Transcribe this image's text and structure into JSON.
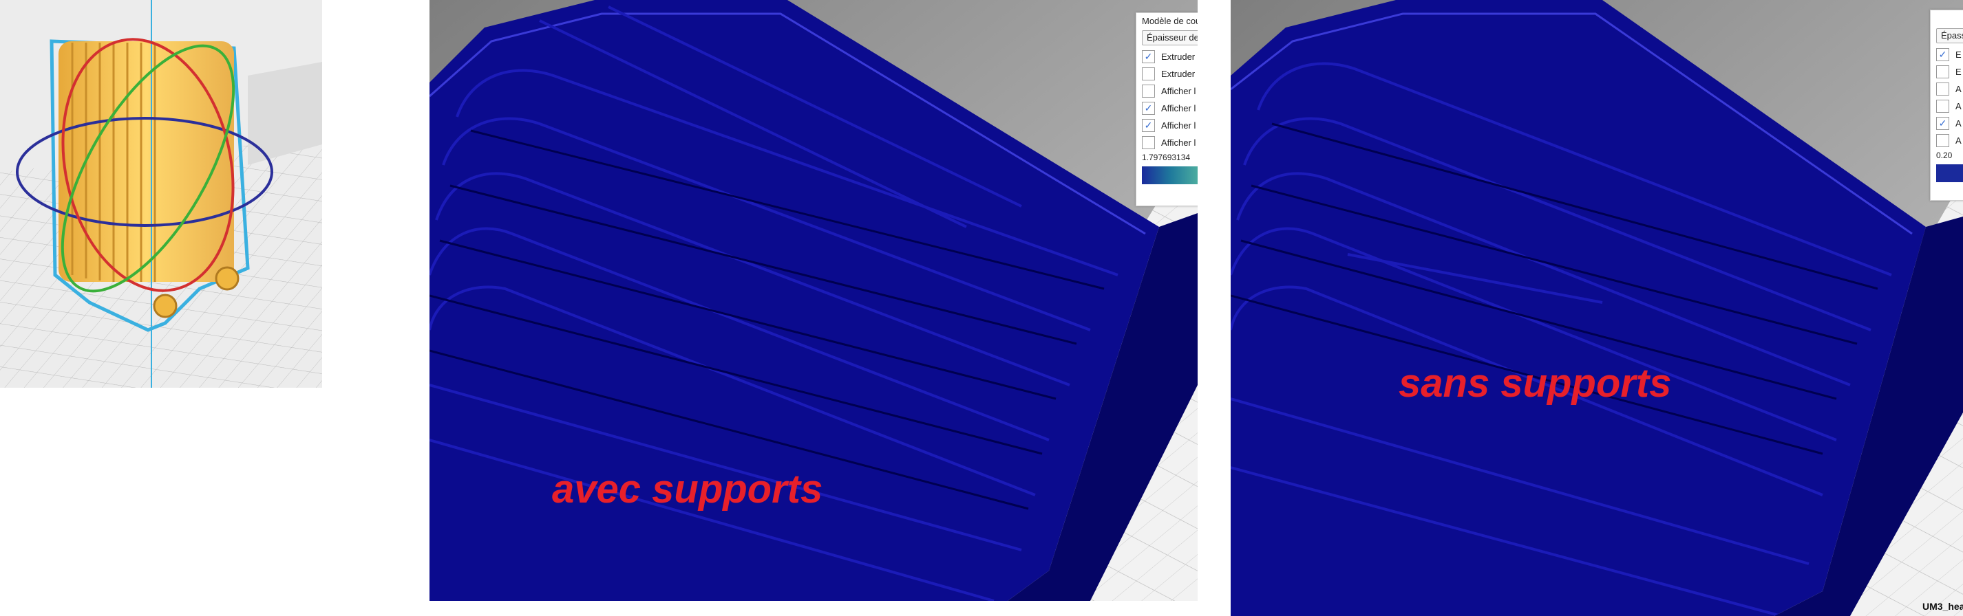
{
  "panels": {
    "overview": {
      "name": "model-overview"
    },
    "with_supports": {
      "caption": "avec supports",
      "legend": {
        "header": "Modèle de cou",
        "select": "Épaisseur de",
        "items": [
          {
            "label": "Extruder",
            "checked": true
          },
          {
            "label": "Extruder",
            "checked": false
          },
          {
            "label": "Afficher l",
            "checked": false
          },
          {
            "label": "Afficher l",
            "checked": true
          },
          {
            "label": "Afficher l",
            "checked": true
          },
          {
            "label": "Afficher l",
            "checked": false
          }
        ],
        "value": "1.797693134",
        "gradient": [
          "#1a2a9c",
          "#1f7a9c",
          "#4fb0a0"
        ]
      }
    },
    "without_supports": {
      "caption": "sans supports",
      "legend": {
        "items": [
          {
            "label": "E",
            "checked": true
          },
          {
            "label": "E",
            "checked": false
          },
          {
            "label": "A",
            "checked": false
          },
          {
            "label": "A",
            "checked": false
          },
          {
            "label": "A",
            "checked": true
          },
          {
            "label": "A",
            "checked": false
          }
        ],
        "select": "Épass",
        "value": "0.20",
        "gradient": [
          "#1a2a9c",
          "#1a2a9c"
        ]
      },
      "filename": "UM3_hea"
    }
  },
  "colors": {
    "extrusion": "#0a0a8a",
    "caption": "#e8202a",
    "model": "#f5c242",
    "selection_outline": "#3ab0e0"
  }
}
